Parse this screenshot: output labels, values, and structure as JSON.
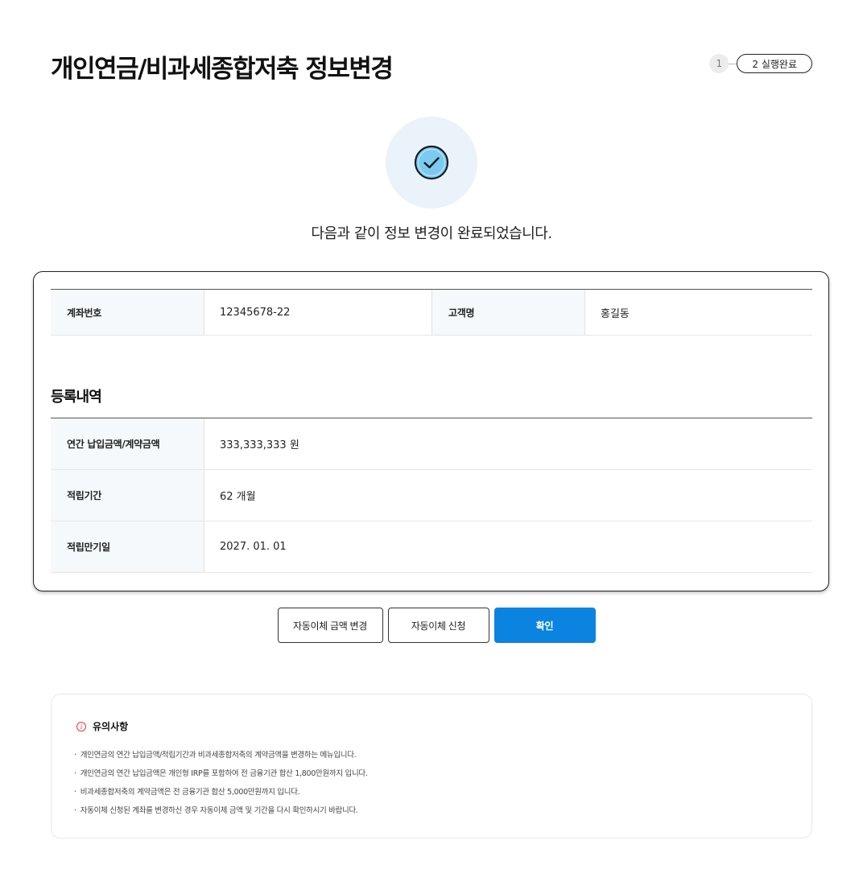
{
  "header": {
    "title": "개인연금/비과세종합저축 정보변경",
    "steps": {
      "step1": "1",
      "step2": "2 실행완료"
    }
  },
  "result": {
    "icon": "check-circle-icon",
    "message": "다음과 같이 정보 변경이 완료되었습니다."
  },
  "account": {
    "account_no_label": "계좌번호",
    "account_no": "12345678-22",
    "customer_label": "고객명",
    "customer": "홍길동"
  },
  "registration": {
    "title": "등록내역",
    "rows": [
      {
        "label": "연간 납입금액/계약금액",
        "value": "333,333,333 원"
      },
      {
        "label": "적립기간",
        "value": "62 개월"
      },
      {
        "label": "적립만기일",
        "value": "2027. 01. 01"
      }
    ]
  },
  "buttons": {
    "change_amount": "자동이체 금액 변경",
    "apply_transfer": "자동이체 신청",
    "confirm": "확인"
  },
  "notice": {
    "icon": "info-icon",
    "title": "유의사항",
    "items": [
      "개인연금의 연간 납입금액/적립기간과 비과세종합저축의 계약금액을 변경하는 메뉴입니다.",
      "개인연금의 연간 납입금액은 개인형 IRP를 포함하여 전 금융기관 합산 1,800만원까지 입니다.",
      "비과세종합저축의 계약금액은 전 금융기관 합산 5,000만원까지 입니다.",
      "자동이체 신청된 계좌를 변경하신 경우 자동이체 금액 및 기간을 다시 확인하시기 바랍니다."
    ]
  },
  "colors": {
    "primary": "#0a84e0",
    "check_bg": "#eaf2fa",
    "check_fill": "#7ccaf0",
    "warning": "#e53935"
  }
}
